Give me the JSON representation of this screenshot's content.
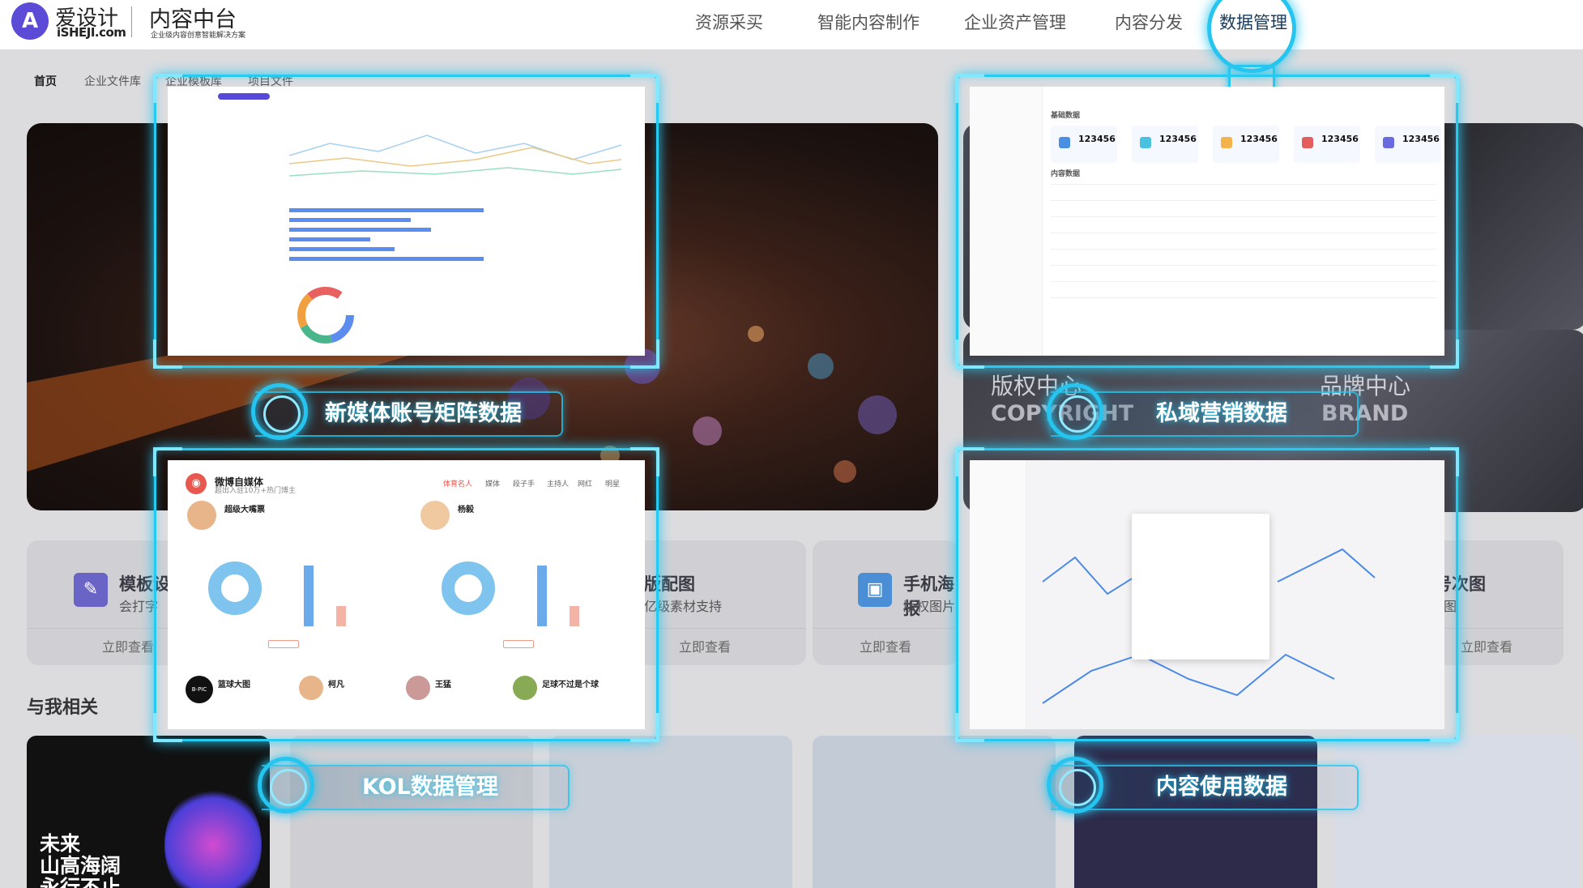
{
  "brand": {
    "logo_char": "A",
    "name": "爱设计",
    "domain": "iSHEJI.com",
    "platform": "内容中台",
    "platform_tagline": "企业级内容创意智能解决方案"
  },
  "nav": [
    {
      "label": "资源采买"
    },
    {
      "label": "智能内容制作"
    },
    {
      "label": "企业资产管理"
    },
    {
      "label": "内容分发"
    },
    {
      "label": "数据管理"
    }
  ],
  "breadcrumb": [
    {
      "label": "首页"
    },
    {
      "label": "企业文件库"
    },
    {
      "label": "企业模板库"
    },
    {
      "label": "项目文件"
    }
  ],
  "banners": {
    "copyright_cn": "版权中心",
    "copyright_en": "COPYRIGHT",
    "brand_cn": "品牌中心",
    "brand_en": "BRAND"
  },
  "features": [
    {
      "title": "模板设",
      "desc": "会打字",
      "link": "立即查看"
    },
    {
      "title": "版配图",
      "desc": "亿级素材支持",
      "link": "立即查看"
    },
    {
      "title": "手机海报",
      "desc": "版权图片",
      "link": "立即查看"
    },
    {
      "title": "众号次图",
      "desc": "辑配图",
      "link": "立即查看"
    }
  ],
  "related": {
    "heading": "与我相关",
    "card1_text": [
      "未来",
      "山高海阔",
      "永行不止。"
    ]
  },
  "overlays": [
    {
      "label": "新媒体账号矩阵数据"
    },
    {
      "label": "私域营销数据"
    },
    {
      "label": "KOL数据管理"
    },
    {
      "label": "内容使用数据"
    }
  ],
  "private_domain": {
    "section_basic": "基础数据",
    "section_content": "内容数据",
    "kpis": [
      "123456",
      "123456",
      "123456",
      "123456",
      "123456"
    ]
  },
  "kol": {
    "title": "微博自媒体",
    "subtitle": "超出入驻10万+热门博主",
    "tabs": [
      "体育名人",
      "媒体",
      "段子手",
      "主持人",
      "网红",
      "明星"
    ],
    "top": [
      {
        "name": "超级大嘴票"
      },
      {
        "name": "杨毅"
      }
    ],
    "bottom": [
      {
        "name": "篮球大图"
      },
      {
        "name": "柯凡"
      },
      {
        "name": "王猛"
      },
      {
        "name": "足球不过是个球"
      }
    ],
    "badge": "B-PIC"
  }
}
